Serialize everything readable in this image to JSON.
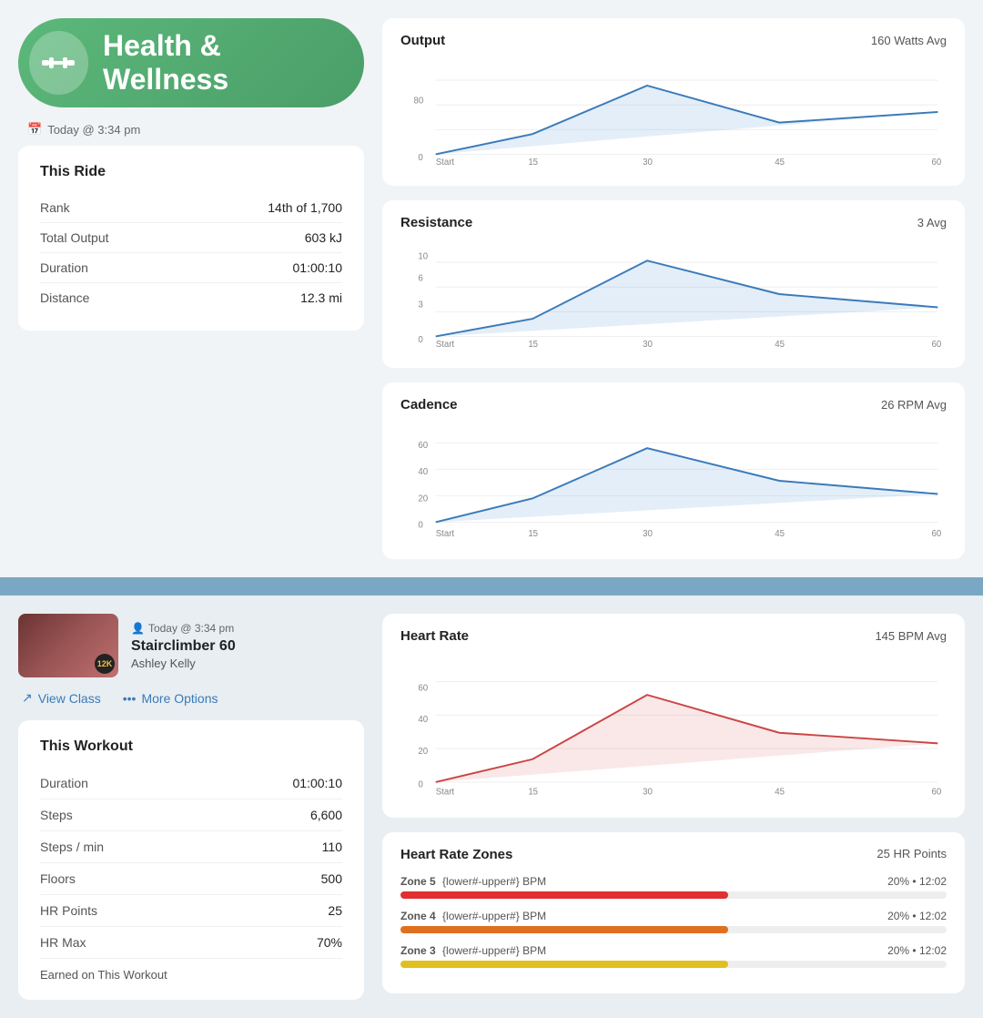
{
  "app": {
    "title": "Health & Wellness"
  },
  "top_timestamp": "Today @ 3:34 pm",
  "this_ride": {
    "title": "This Ride",
    "rows": [
      {
        "label": "Rank",
        "value": "14th of 1,700"
      },
      {
        "label": "Total Output",
        "value": "603 kJ"
      },
      {
        "label": "Duration",
        "value": "01:00:10"
      },
      {
        "label": "Distance",
        "value": "12.3 mi"
      }
    ]
  },
  "charts_top": [
    {
      "title": "Output",
      "avg": "160 Watts Avg",
      "color": "#3a7ab8",
      "fill": "rgba(100,160,220,0.2)",
      "x_labels": [
        "Start",
        "15",
        "30",
        "45",
        "60"
      ],
      "y_labels": [
        "0",
        "",
        "",
        ""
      ],
      "y_max_label": "160"
    },
    {
      "title": "Resistance",
      "avg": "3 Avg",
      "color": "#3a7ab8",
      "fill": "rgba(100,160,220,0.2)",
      "x_labels": [
        "Start",
        "15",
        "30",
        "45",
        "60"
      ]
    },
    {
      "title": "Cadence",
      "avg": "26 RPM Avg",
      "color": "#3a7ab8",
      "fill": "rgba(100,160,220,0.2)",
      "x_labels": [
        "Start",
        "15",
        "30",
        "45",
        "60"
      ]
    }
  ],
  "bottom_timestamp": "Today @ 3:34 pm",
  "workout": {
    "name": "Stairclimber 60",
    "instructor": "Ashley Kelly",
    "badge": "12K"
  },
  "actions": {
    "view_class": "View Class",
    "more_options": "More Options"
  },
  "this_workout": {
    "title": "This Workout",
    "rows": [
      {
        "label": "Duration",
        "value": "01:00:10"
      },
      {
        "label": "Steps",
        "value": "6,600"
      },
      {
        "label": "Steps / min",
        "value": "110"
      },
      {
        "label": "Floors",
        "value": "500"
      },
      {
        "label": "HR Points",
        "value": "25"
      },
      {
        "label": "HR Max",
        "value": "70%"
      }
    ],
    "earned": "Earned on This Workout"
  },
  "heart_rate": {
    "title": "Heart Rate",
    "avg": "145 BPM Avg",
    "color": "#cc4444",
    "fill": "rgba(220,100,100,0.15)",
    "x_labels": [
      "Start",
      "15",
      "30",
      "45",
      "60"
    ],
    "y_labels": [
      "0",
      "20",
      "40",
      "60"
    ]
  },
  "hr_zones": {
    "title": "Heart Rate Zones",
    "points": "25 HR Points",
    "zones": [
      {
        "label": "Zone 5",
        "bpm": "{lower#-upper#} BPM",
        "stat": "20% • 12:02",
        "color": "zone5-color",
        "pct": 60
      },
      {
        "label": "Zone 4",
        "bpm": "{lower#-upper#} BPM",
        "stat": "20% • 12:02",
        "color": "zone4-color",
        "pct": 60
      },
      {
        "label": "Zone 3",
        "bpm": "{lower#-upper#} BPM",
        "stat": "20% • 12:02",
        "color": "zone3-color",
        "pct": 60
      }
    ]
  }
}
